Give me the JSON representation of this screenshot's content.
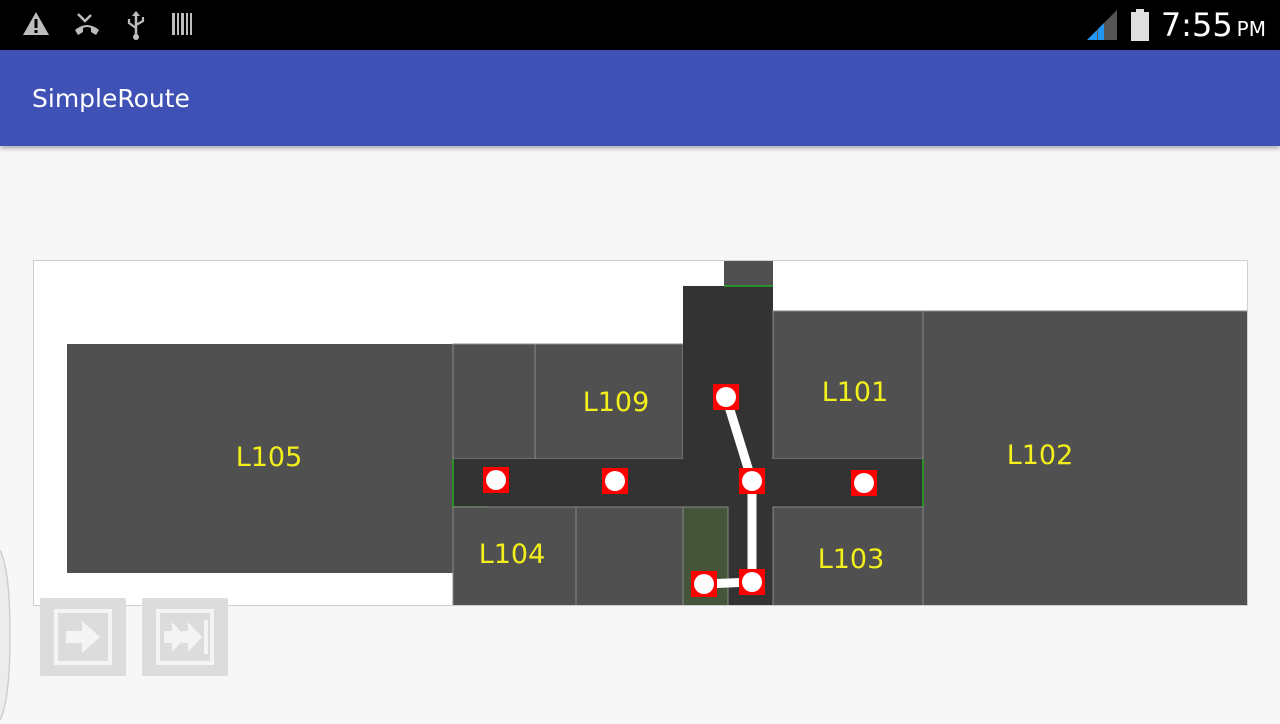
{
  "status_bar": {
    "time": "7:55",
    "ampm": "PM",
    "icons": [
      "warning-icon",
      "missed-call-icon",
      "usb-icon",
      "barcode-icon",
      "signal-icon",
      "battery-icon"
    ]
  },
  "app_bar": {
    "title": "SimpleRoute",
    "color": "#3f51b5"
  },
  "map": {
    "rooms": [
      {
        "id": "L105",
        "label": "L105"
      },
      {
        "id": "L109",
        "label": "L109"
      },
      {
        "id": "L101",
        "label": "L101"
      },
      {
        "id": "L102",
        "label": "L102"
      },
      {
        "id": "L104",
        "label": "L104"
      },
      {
        "id": "L103",
        "label": "L103"
      }
    ],
    "room_color": "#505050",
    "corridor_color": "#333333",
    "label_color": "#f2ef1a",
    "route_color": "#ffffff",
    "node_color": "#ff0000"
  },
  "controls": {
    "next_step": {
      "icon": "next-step-icon"
    },
    "skip_to_end": {
      "icon": "skip-to-end-icon"
    }
  }
}
